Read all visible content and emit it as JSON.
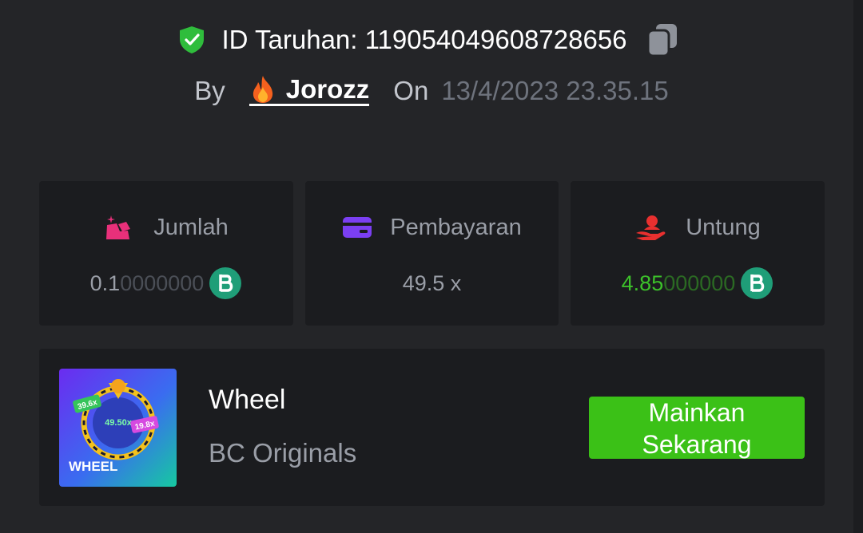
{
  "header": {
    "bet_id_label": "ID Taruhan: 119054049608728656",
    "by_label": "By",
    "username": "Jorozz",
    "on_label": "On",
    "date": "13/4/2023 23.35.15"
  },
  "stats": {
    "amount": {
      "label": "Jumlah",
      "value_main": "0.1",
      "value_dim": "0000000",
      "coin_icon": "bc-coin-icon"
    },
    "payout": {
      "label": "Pembayaran",
      "value": "49.5 x"
    },
    "profit": {
      "label": "Untung",
      "value_main": "4.85",
      "value_dim": "000000",
      "coin_icon": "bc-coin-icon"
    }
  },
  "game": {
    "name": "Wheel",
    "provider": "BC Originals",
    "play_button": "Mainkan Sekarang",
    "thumbnail": {
      "title": "WHEEL",
      "badge_left": "39.6x",
      "badge_center": "49.50x",
      "badge_right": "19.8x"
    }
  },
  "colors": {
    "background": "#242528",
    "card": "#1b1c1f",
    "accent_green": "#3bc117",
    "shield_green": "#2fbd3c",
    "coin_teal": "#1f9e78",
    "payout_purple": "#7b3ff2",
    "amount_pink": "#e8307a",
    "profit_red": "#e8302f"
  }
}
